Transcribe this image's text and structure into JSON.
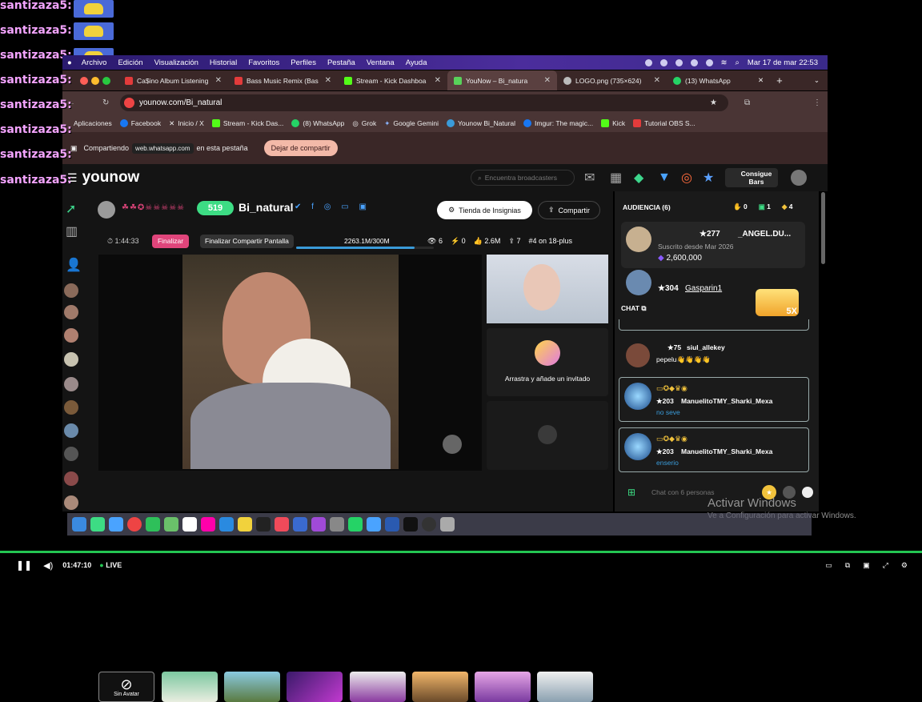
{
  "chat_overlay": {
    "name": "santizaza5:"
  },
  "menubar": {
    "items": [
      "Archivo",
      "Edición",
      "Visualización",
      "Historial",
      "Favoritos",
      "Perfiles",
      "Pestaña",
      "Ventana",
      "Ayuda"
    ],
    "datetime": "Mar 17 de mar  22:53"
  },
  "tabs": [
    {
      "title": "Ca$ino Album Listening",
      "color": "#e23b3b"
    },
    {
      "title": "Bass Music Remix (Bas",
      "color": "#e23b3b"
    },
    {
      "title": "Stream - Kick Dashboa",
      "color": "#53fc18"
    },
    {
      "title": "YouNow – Bi_natura",
      "color": "#58d25a"
    },
    {
      "title": "LOGO.png (735×624)",
      "color": "#bbbbbb"
    },
    {
      "title": "(13) WhatsApp",
      "color": "#25d366"
    }
  ],
  "address": {
    "url": "younow.com/Bi_natural"
  },
  "bookmarks": [
    "Aplicaciones",
    "Facebook",
    "Inicio / X",
    "Stream - Kick Das...",
    "(8) WhatsApp",
    "Grok",
    "Google Gemini",
    "Younow Bi_Natural",
    "Imgur: The magic...",
    "Kick",
    "Tutorial OBS S..."
  ],
  "sharebar": {
    "label": "Compartiendo",
    "domain": "web.whatsapp.com",
    "suffix": "en esta pestaña",
    "stop_button": "Dejar de compartir"
  },
  "younow": {
    "logo": "younow",
    "search_placeholder": "Encuentra broadcasters",
    "bars_button": "Consigue Bars",
    "level": "519",
    "username": "Bi_natural",
    "store_button": "Tienda de Insignias",
    "share_button": "Compartir",
    "timer": "1:44:33",
    "finish_button": "Finalizar",
    "finish_share_button": "Finalizar Compartir Pantalla",
    "progress_text": "2263.1M/300M",
    "progress_fraction": 0.86,
    "viewers": "6",
    "zaps": "0",
    "likes": "2.6M",
    "shares": "7",
    "rank": "#4 on 18-plus",
    "invite_text": "Arrastra y añade un invitado",
    "no_avatar_label": "Sin Avatar",
    "audience": {
      "title": "AUDIENCIA (6)",
      "counts": [
        "0",
        "1",
        "4"
      ],
      "members": [
        {
          "level": "★277",
          "name": "_ANGEL.DU...",
          "since": "Suscrito desde Mar 2026",
          "coins": "2,600,000"
        },
        {
          "level": "★304",
          "name": "Gasparin1"
        }
      ]
    },
    "chat_label": "CHAT",
    "gift_badge": "5X",
    "messages": [
      {
        "level": "★75",
        "name": "siul_allekey",
        "text": "pepelu👋👋👋👋"
      },
      {
        "level": "★203",
        "name": "ManuelitoTMY_Sharki_Mexa",
        "text": "no seve"
      },
      {
        "level": "★203",
        "name": "ManuelitoTMY_Sharki_Mexa",
        "text": "enserio"
      }
    ],
    "chat_placeholder": "Chat con 6 personas"
  },
  "watermark": {
    "title": "Activar Windows",
    "subtitle": "Ve a Configuración para activar Windows."
  },
  "player": {
    "time": "01:47:10",
    "live": "LIVE"
  }
}
